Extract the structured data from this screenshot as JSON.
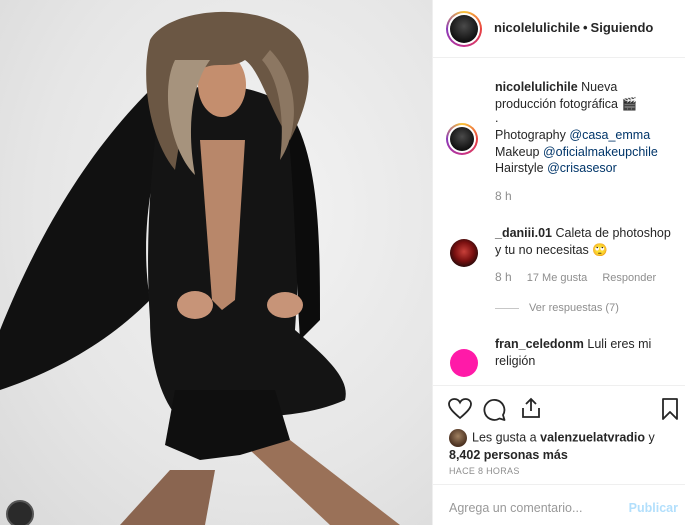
{
  "post": {
    "icons": {
      "nav": "carousel-nav-dot"
    }
  },
  "header": {
    "username": "nicolelulichile",
    "separator": "•",
    "follow_status": "Siguiendo"
  },
  "caption": {
    "username": "nicolelulichile",
    "text": "Nueva producción fotográfica 🎬",
    "dot": ".",
    "credits": [
      {
        "label": "Photography",
        "mention": "@casa_emma"
      },
      {
        "label": "Makeup",
        "mention": "@oficialmakeupchile"
      },
      {
        "label": "Hairstyle",
        "mention": "@crisasesor"
      }
    ],
    "time": "8 h"
  },
  "comments": [
    {
      "username": "_daniii.01",
      "text": "Caleta de photoshop y tu no necesitas 🙄",
      "time": "8 h",
      "likes": "17 Me gusta",
      "reply": "Responder",
      "view_replies": "Ver respuestas (7)"
    },
    {
      "username": "fran_celedonm",
      "text": "Luli eres mi religión"
    }
  ],
  "actions": {
    "icons": [
      "heart-icon",
      "comment-icon",
      "share-icon",
      "bookmark-icon"
    ],
    "likes_prefix": "Les gusta a",
    "likes_user": "valenzuelatvradio",
    "likes_conj": "y",
    "likes_count": "8,402 personas más",
    "time_ago": "HACE 8 HORAS"
  },
  "add_comment": {
    "placeholder": "Agrega un comentario...",
    "publish": "Publicar"
  },
  "colors": {
    "mention": "#003569",
    "muted": "#8e8e8e",
    "border": "#efefef",
    "story_ring": [
      "#f9c53a",
      "#e8413f",
      "#c4318d",
      "#8a3ab9"
    ]
  }
}
